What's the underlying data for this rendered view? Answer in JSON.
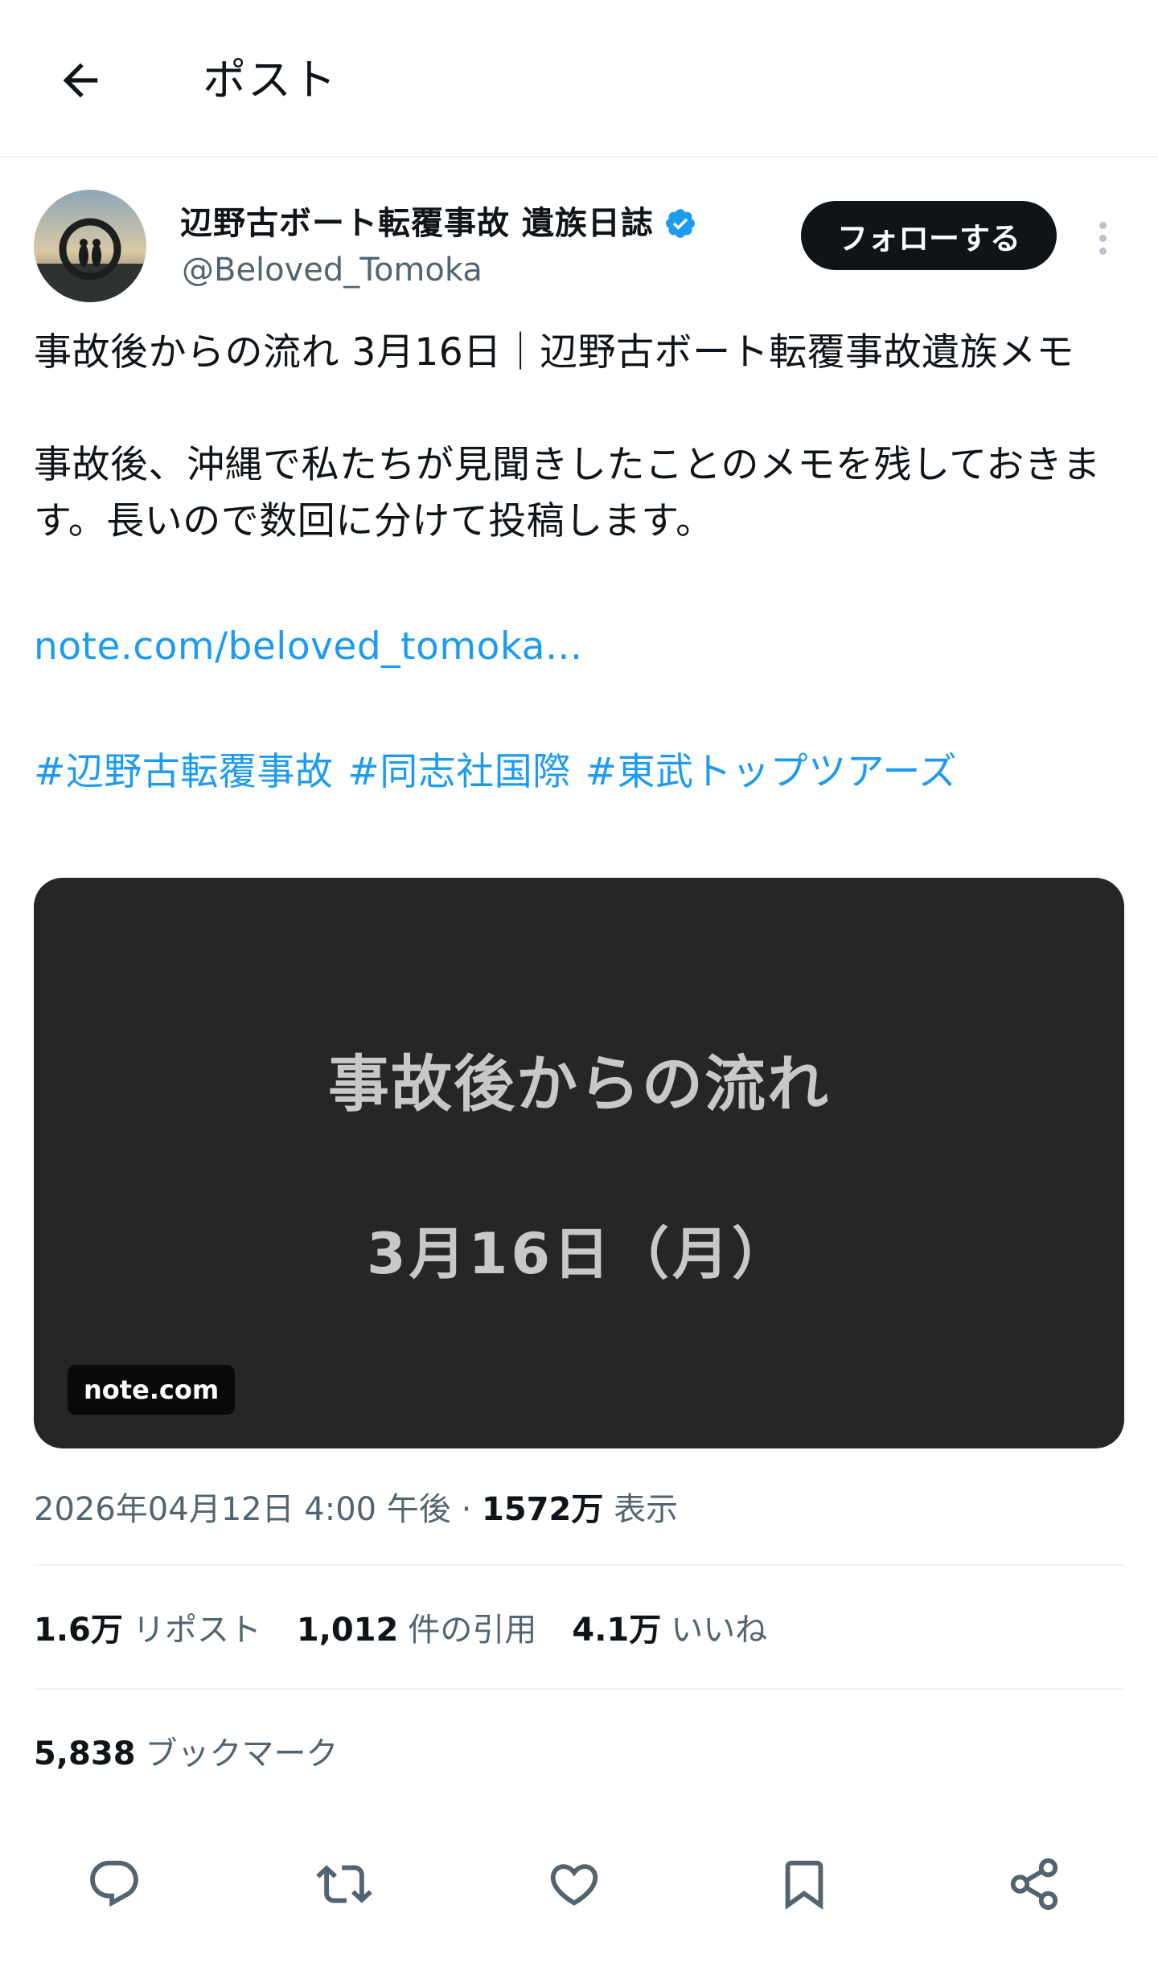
{
  "header": {
    "back_icon": "arrow-left-icon",
    "title": "ポスト"
  },
  "author": {
    "display_name": "辺野古ボート転覆事故 遺族日誌",
    "handle": "@Beloved_Tomoka",
    "verified": true,
    "follow_label": "フォローする",
    "more_icon": "more-vertical-icon"
  },
  "tweet": {
    "line1": "事故後からの流れ 3月16日｜辺野古ボート転覆事故遺族メモ",
    "line2": "事故後、沖縄で私たちが見聞きしたことのメモを残しておきます。長いので数回に分けて投稿します。",
    "link": "note.com/beloved_tomoka...",
    "hashtags": [
      "#辺野古転覆事故",
      "#同志社国際",
      "#東武トップツアーズ"
    ]
  },
  "card": {
    "title": "事故後からの流れ",
    "date": "3月16日（月）",
    "domain": "note.com"
  },
  "meta": {
    "timestamp": "2026年04月12日 4:00 午後",
    "separator": "·",
    "views_count": "1572万",
    "views_label": "表示"
  },
  "stats": {
    "reposts_count": "1.6万",
    "reposts_label": "リポスト",
    "quotes_count": "1,012",
    "quotes_label": "件の引用",
    "likes_count": "4.1万",
    "likes_label": "いいね"
  },
  "bookmarks": {
    "count": "5,838",
    "label": "ブックマーク"
  },
  "actions": [
    "reply-icon",
    "repost-icon",
    "like-icon",
    "bookmark-icon",
    "share-icon"
  ],
  "colors": {
    "link": "#1d9bf0",
    "verified": "#1d9bf0",
    "text": "#0f1419",
    "secondary": "#536471",
    "card_bg": "#262626"
  }
}
